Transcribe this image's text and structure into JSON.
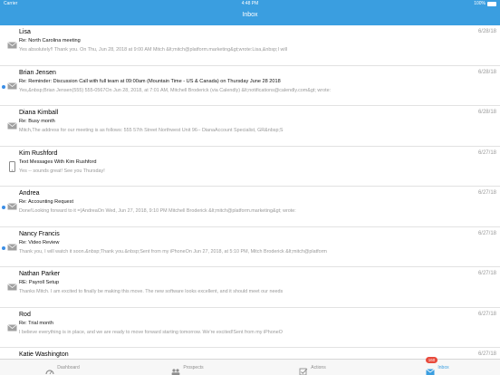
{
  "status_bar": {
    "carrier": "Carrier",
    "time": "4:48 PM",
    "battery": "100%"
  },
  "nav": {
    "title": "Inbox"
  },
  "colors": {
    "brand": "#3a9ee0",
    "unread_dot": "#3a8ee6",
    "badge": "#e84a3c"
  },
  "messages": [
    {
      "sender": "Lisa",
      "date": "6/28/18",
      "subject": "Re: North Carolina meeting",
      "preview": "Yes absolutely!! Thank you. On Thu, Jun 28, 2018 at 9:00 AM Mitch &lt;mitch@platform.marketing&gt;wrote:Lisa,&nbsp;I will",
      "icon": "envelope-icon",
      "unread": false
    },
    {
      "sender": "Brian Jensen",
      "date": "6/28/18",
      "subject": "Re: Reminder: Discussion Call with full team at 09:00am (Mountain Time - US & Canada) on Thursday  June 28  2018",
      "preview": "Yes,&nbsp;Brian Jensen(555) 555-0567On Jun 28, 2018, at 7:01 AM, Mitchell Broderick (via Calendly) &lt;notifications@calendly.com&gt; wrote:",
      "icon": "envelope-icon",
      "unread": true
    },
    {
      "sender": "Diana Kimball",
      "date": "6/28/18",
      "subject": "Re: Busy month",
      "preview": "Mitch,The address for our meeting is as follows: 555 57th Street Northwest Unit 96-- DianaAccount Specialist, GR&nbsp;S",
      "icon": "envelope-icon",
      "unread": false
    },
    {
      "sender": "Kim Rushford",
      "date": "6/27/18",
      "subject": "Text Messages With Kim Rushford",
      "preview": "Yes -- sounds great! See you Thursday!",
      "icon": "phone-icon",
      "unread": false
    },
    {
      "sender": "Andrea",
      "date": "6/27/18",
      "subject": "Re: Accounting Request",
      "preview": "Done!Looking forward to it =)AndreaOn Wed, Jun 27, 2018, 9:10 PM Mitchell Broderick &lt;mitch@platform.marketing&gt; wrote:",
      "icon": "envelope-icon",
      "unread": true
    },
    {
      "sender": "Nancy Francis",
      "date": "6/27/18",
      "subject": "Re: Video Review",
      "preview": "Thank you, I will watch it soon.&nbsp;Thank you.&nbsp;Sent from my iPhoneOn Jun 27, 2018, at 5:10 PM, Mitch Broderick &lt;mitch@platform",
      "icon": "envelope-icon",
      "unread": true
    },
    {
      "sender": "Nathan Parker",
      "date": "6/27/18",
      "subject": "RE: Payroll Setup",
      "preview": "Thanks Mitch. I am excited to finally be making this move. The new software looks excellent, and it should meet our needs",
      "icon": "envelope-icon",
      "unread": false
    },
    {
      "sender": "Rod",
      "date": "6/27/18",
      "subject": "Re: Trial month",
      "preview": "I believe everything is in place, and we are ready to move forward starting tomorrow. We're excited!Sent from my iPhoneO",
      "icon": "envelope-icon",
      "unread": false
    },
    {
      "sender": "Katie Washington",
      "date": "6/27/18",
      "subject": "",
      "preview": "",
      "icon": "envelope-icon",
      "unread": false
    }
  ],
  "tabs": [
    {
      "label": "Dashboard",
      "icon": "dashboard-icon"
    },
    {
      "label": "Prospects",
      "icon": "people-icon"
    },
    {
      "label": "Actions",
      "icon": "checkbox-icon"
    },
    {
      "label": "Inbox",
      "icon": "inbox-envelope-icon",
      "badge": "160",
      "active": true
    }
  ]
}
